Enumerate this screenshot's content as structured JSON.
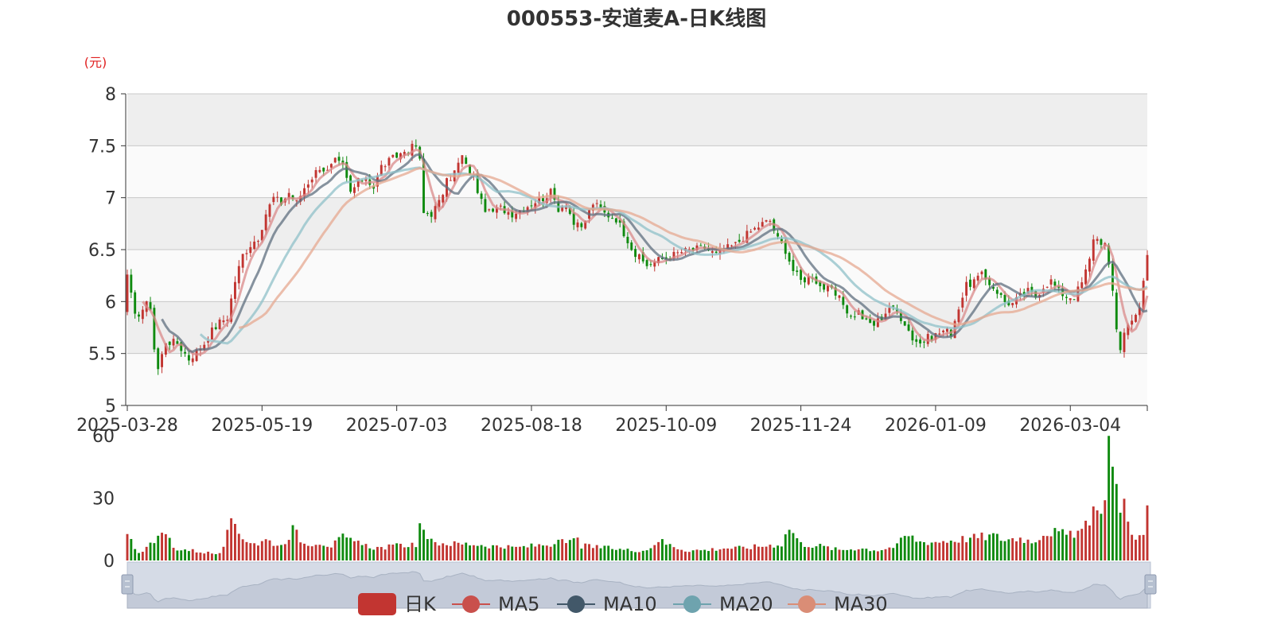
{
  "chart_data": {
    "type": "candlestick",
    "title": "000553-安道麦A-日K线图",
    "unit_label": "(元)",
    "price_axis": {
      "ylim": [
        5,
        8
      ],
      "ticks": [
        "5",
        "5.5",
        "6",
        "6.5",
        "7",
        "7.5",
        "8"
      ]
    },
    "volume_axis": {
      "ylim": [
        0,
        60
      ],
      "ticks": [
        "0",
        "30",
        "60"
      ]
    },
    "x_tick_labels": [
      "2025-03-28",
      "2025-05-19",
      "2025-07-03",
      "2025-08-18",
      "2025-10-09",
      "2025-11-24",
      "2026-01-09",
      "2026-03-04"
    ],
    "x_tick_index": [
      0,
      35,
      70,
      105,
      140,
      175,
      210,
      245
    ],
    "num_days": 266,
    "legend": [
      "日K",
      "MA5",
      "MA10",
      "MA20",
      "MA30"
    ],
    "legend_position": "bottom-center",
    "colors": {
      "up": "#c23531",
      "down": "#0f8a0f",
      "ma5": "#d98a8a",
      "ma10": "#5f6f7f",
      "ma20": "#8fc0c8",
      "ma30": "#e6a890",
      "band": "#eeeeee",
      "grid": "#c8c8c8",
      "zoom_fill": "#d5dbe6"
    },
    "close_keypoints": [
      [
        0,
        6.26
      ],
      [
        2,
        5.85
      ],
      [
        5,
        5.97
      ],
      [
        6,
        5.95
      ],
      [
        7,
        5.55
      ],
      [
        8,
        5.35
      ],
      [
        10,
        5.62
      ],
      [
        13,
        5.6
      ],
      [
        16,
        5.45
      ],
      [
        18,
        5.52
      ],
      [
        20,
        5.6
      ],
      [
        22,
        5.72
      ],
      [
        24,
        5.8
      ],
      [
        26,
        5.85
      ],
      [
        28,
        6.2
      ],
      [
        30,
        6.45
      ],
      [
        32,
        6.55
      ],
      [
        34,
        6.62
      ],
      [
        35,
        6.65
      ],
      [
        36,
        6.85
      ],
      [
        38,
        7.0
      ],
      [
        40,
        6.95
      ],
      [
        42,
        7.05
      ],
      [
        44,
        6.95
      ],
      [
        46,
        7.1
      ],
      [
        48,
        7.2
      ],
      [
        50,
        7.3
      ],
      [
        52,
        7.25
      ],
      [
        54,
        7.35
      ],
      [
        56,
        7.3
      ],
      [
        58,
        7.05
      ],
      [
        60,
        7.15
      ],
      [
        62,
        7.2
      ],
      [
        64,
        7.1
      ],
      [
        66,
        7.3
      ],
      [
        68,
        7.35
      ],
      [
        70,
        7.4
      ],
      [
        72,
        7.45
      ],
      [
        75,
        7.5
      ],
      [
        76,
        7.35
      ],
      [
        77,
        6.85
      ],
      [
        79,
        6.85
      ],
      [
        81,
        6.95
      ],
      [
        83,
        7.15
      ],
      [
        85,
        7.25
      ],
      [
        87,
        7.4
      ],
      [
        88,
        7.3
      ],
      [
        90,
        7.2
      ],
      [
        92,
        6.95
      ],
      [
        94,
        6.85
      ],
      [
        97,
        6.9
      ],
      [
        100,
        6.85
      ],
      [
        103,
        6.9
      ],
      [
        105,
        6.95
      ],
      [
        108,
        7.0
      ],
      [
        110,
        7.05
      ],
      [
        112,
        6.9
      ],
      [
        114,
        6.95
      ],
      [
        116,
        6.75
      ],
      [
        118,
        6.7
      ],
      [
        121,
        6.95
      ],
      [
        124,
        6.85
      ],
      [
        127,
        6.8
      ],
      [
        130,
        6.6
      ],
      [
        132,
        6.45
      ],
      [
        135,
        6.35
      ],
      [
        138,
        6.4
      ],
      [
        140,
        6.42
      ],
      [
        142,
        6.45
      ],
      [
        144,
        6.48
      ],
      [
        147,
        6.5
      ],
      [
        150,
        6.52
      ],
      [
        153,
        6.45
      ],
      [
        155,
        6.5
      ],
      [
        158,
        6.55
      ],
      [
        160,
        6.62
      ],
      [
        163,
        6.7
      ],
      [
        165,
        6.75
      ],
      [
        167,
        6.78
      ],
      [
        169,
        6.6
      ],
      [
        171,
        6.5
      ],
      [
        173,
        6.3
      ],
      [
        175,
        6.2
      ],
      [
        178,
        6.25
      ],
      [
        180,
        6.15
      ],
      [
        183,
        6.1
      ],
      [
        186,
        5.98
      ],
      [
        188,
        5.85
      ],
      [
        190,
        5.9
      ],
      [
        192,
        5.8
      ],
      [
        194,
        5.78
      ],
      [
        196,
        5.85
      ],
      [
        198,
        5.95
      ],
      [
        200,
        5.9
      ],
      [
        202,
        5.8
      ],
      [
        204,
        5.65
      ],
      [
        206,
        5.6
      ],
      [
        208,
        5.65
      ],
      [
        210,
        5.68
      ],
      [
        212,
        5.72
      ],
      [
        214,
        5.7
      ],
      [
        216,
        5.95
      ],
      [
        218,
        6.15
      ],
      [
        220,
        6.2
      ],
      [
        222,
        6.25
      ],
      [
        224,
        6.18
      ],
      [
        226,
        6.1
      ],
      [
        228,
        6.0
      ],
      [
        230,
        5.98
      ],
      [
        232,
        6.05
      ],
      [
        234,
        6.1
      ],
      [
        236,
        6.05
      ],
      [
        238,
        6.15
      ],
      [
        240,
        6.2
      ],
      [
        242,
        6.1
      ],
      [
        244,
        6.05
      ],
      [
        246,
        6.05
      ],
      [
        248,
        6.18
      ],
      [
        250,
        6.4
      ],
      [
        251,
        6.62
      ],
      [
        253,
        6.58
      ],
      [
        254,
        6.55
      ],
      [
        256,
        6.1
      ],
      [
        257,
        5.75
      ],
      [
        258,
        5.55
      ],
      [
        259,
        5.7
      ],
      [
        261,
        5.85
      ],
      [
        263,
        5.92
      ],
      [
        265,
        6.45
      ]
    ],
    "volume_keypoints": [
      [
        0,
        12
      ],
      [
        3,
        4
      ],
      [
        8,
        10
      ],
      [
        10,
        14
      ],
      [
        12,
        6
      ],
      [
        20,
        4
      ],
      [
        24,
        3
      ],
      [
        27,
        17
      ],
      [
        30,
        11
      ],
      [
        34,
        8
      ],
      [
        36,
        10
      ],
      [
        40,
        7
      ],
      [
        43,
        15
      ],
      [
        46,
        8
      ],
      [
        50,
        9
      ],
      [
        53,
        7
      ],
      [
        56,
        11
      ],
      [
        60,
        8
      ],
      [
        65,
        6
      ],
      [
        70,
        7
      ],
      [
        75,
        8
      ],
      [
        76,
        15
      ],
      [
        77,
        17
      ],
      [
        78,
        9
      ],
      [
        85,
        8
      ],
      [
        90,
        8
      ],
      [
        95,
        7
      ],
      [
        100,
        6
      ],
      [
        105,
        7
      ],
      [
        110,
        8
      ],
      [
        115,
        9
      ],
      [
        117,
        10
      ],
      [
        118,
        7
      ],
      [
        125,
        6
      ],
      [
        130,
        5
      ],
      [
        135,
        5
      ],
      [
        138,
        10
      ],
      [
        140,
        8
      ],
      [
        145,
        5
      ],
      [
        150,
        5
      ],
      [
        155,
        6
      ],
      [
        160,
        6
      ],
      [
        165,
        7
      ],
      [
        170,
        8
      ],
      [
        172,
        16
      ],
      [
        175,
        8
      ],
      [
        180,
        7
      ],
      [
        185,
        5
      ],
      [
        190,
        6
      ],
      [
        195,
        5
      ],
      [
        200,
        7
      ],
      [
        202,
        12
      ],
      [
        204,
        11
      ],
      [
        206,
        9
      ],
      [
        210,
        9
      ],
      [
        215,
        10
      ],
      [
        220,
        11
      ],
      [
        225,
        12
      ],
      [
        228,
        10
      ],
      [
        232,
        11
      ],
      [
        235,
        9
      ],
      [
        238,
        13
      ],
      [
        240,
        14
      ],
      [
        245,
        12
      ],
      [
        248,
        15
      ],
      [
        250,
        17
      ],
      [
        252,
        30
      ],
      [
        253,
        21
      ],
      [
        254,
        35
      ],
      [
        255,
        58
      ],
      [
        256,
        44
      ],
      [
        257,
        32
      ],
      [
        258,
        27
      ],
      [
        259,
        29
      ],
      [
        260,
        18
      ],
      [
        262,
        12
      ],
      [
        264,
        11
      ],
      [
        265,
        26
      ]
    ]
  }
}
